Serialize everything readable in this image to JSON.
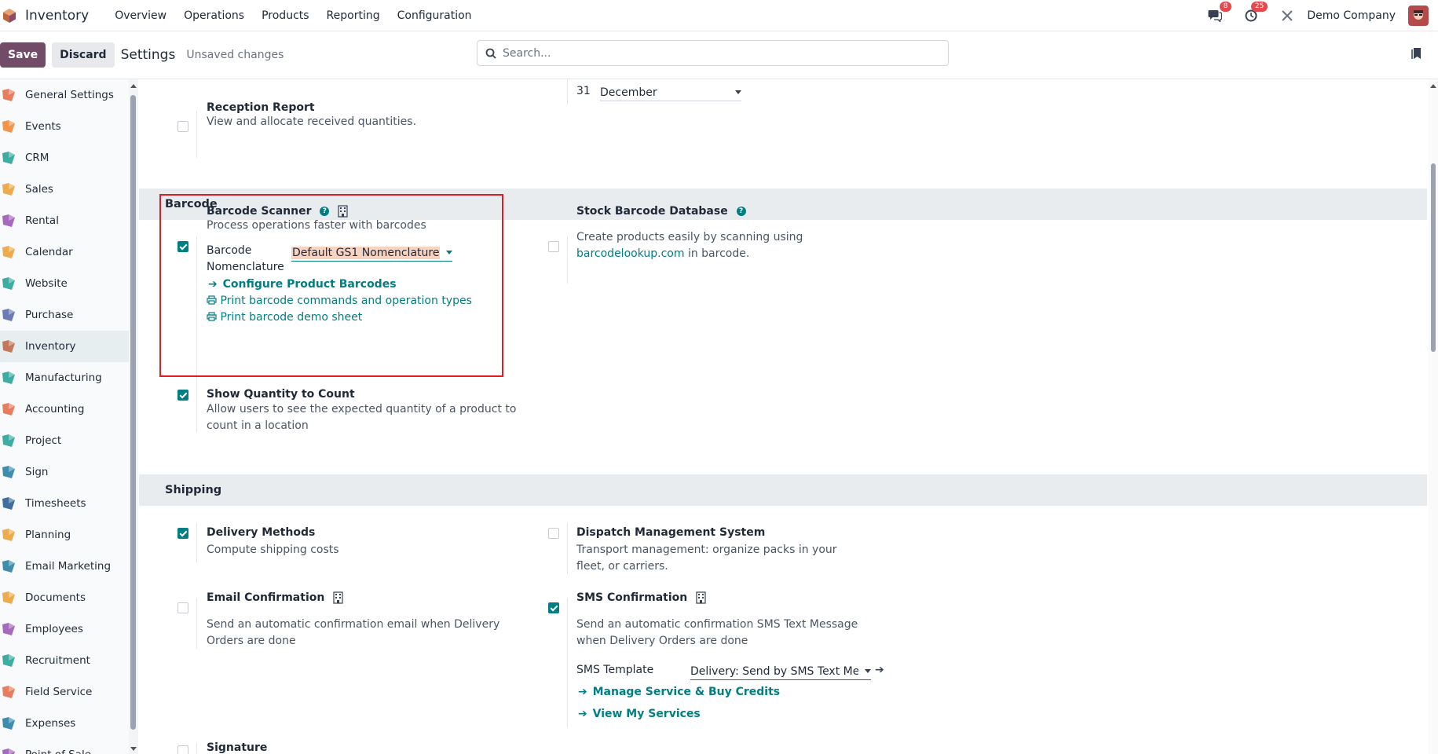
{
  "navbar": {
    "app_name": "Inventory",
    "menu": [
      "Overview",
      "Operations",
      "Products",
      "Reporting",
      "Configuration"
    ],
    "messages_badge": "8",
    "activities_badge": "25",
    "company": "Demo Company"
  },
  "control_panel": {
    "save_label": "Save",
    "discard_label": "Discard",
    "title": "Settings",
    "unsaved": "Unsaved changes",
    "search_placeholder": "Search..."
  },
  "sidebar": {
    "items": [
      {
        "label": "General Settings",
        "icon": "general-settings-icon",
        "color": "#e46f4e"
      },
      {
        "label": "Events",
        "icon": "events-icon",
        "color": "#f08a38"
      },
      {
        "label": "CRM",
        "icon": "crm-icon",
        "color": "#2aa39a"
      },
      {
        "label": "Sales",
        "icon": "sales-icon",
        "color": "#e9a23b"
      },
      {
        "label": "Rental",
        "icon": "rental-icon",
        "color": "#9b59b6"
      },
      {
        "label": "Calendar",
        "icon": "calendar-icon",
        "color": "#e9a23b"
      },
      {
        "label": "Website",
        "icon": "website-icon",
        "color": "#2aa39a"
      },
      {
        "label": "Purchase",
        "icon": "purchase-icon",
        "color": "#5b6dae"
      },
      {
        "label": "Inventory",
        "icon": "inventory-icon",
        "color": "#c06a4a"
      },
      {
        "label": "Manufacturing",
        "icon": "manufacturing-icon",
        "color": "#2aa39a"
      },
      {
        "label": "Accounting",
        "icon": "accounting-icon",
        "color": "#e46f4e"
      },
      {
        "label": "Project",
        "icon": "project-icon",
        "color": "#2aa39a"
      },
      {
        "label": "Sign",
        "icon": "sign-icon",
        "color": "#2a7fa3"
      },
      {
        "label": "Timesheets",
        "icon": "timesheets-icon",
        "color": "#2a5f8f"
      },
      {
        "label": "Planning",
        "icon": "planning-icon",
        "color": "#e9a23b"
      },
      {
        "label": "Email Marketing",
        "icon": "email-marketing-icon",
        "color": "#2a7fa3"
      },
      {
        "label": "Documents",
        "icon": "documents-icon",
        "color": "#e9a23b"
      },
      {
        "label": "Employees",
        "icon": "employees-icon",
        "color": "#9b59b6"
      },
      {
        "label": "Recruitment",
        "icon": "recruitment-icon",
        "color": "#2aa39a"
      },
      {
        "label": "Field Service",
        "icon": "field-service-icon",
        "color": "#e46f4e"
      },
      {
        "label": "Expenses",
        "icon": "expenses-icon",
        "color": "#2a7fa3"
      },
      {
        "label": "Point of Sale",
        "icon": "point-of-sale-icon",
        "color": "#9b59b6"
      }
    ],
    "active_index": 8
  },
  "top_fragment": {
    "day": "31",
    "month": "December"
  },
  "reception_report": {
    "title": "Reception Report",
    "desc": "View and allocate received quantities.",
    "checked": false
  },
  "barcode": {
    "section_title": "Barcode",
    "scanner": {
      "title": "Barcode Scanner",
      "desc": "Process operations faster with barcodes",
      "nomenclature_label": "Barcode Nomenclature",
      "nomenclature_value": "Default GS1 Nomenclature",
      "configure_link": "Configure Product Barcodes",
      "print_commands_link": "Print barcode commands and operation types",
      "print_demo_link": "Print barcode demo sheet",
      "checked": true
    },
    "stock_db": {
      "title": "Stock Barcode Database",
      "desc_before": "Create products easily by scanning using",
      "link": "barcodelookup.com",
      "desc_after": "in barcode.",
      "checked": false
    },
    "show_qty": {
      "title": "Show Quantity to Count",
      "desc": "Allow users to see the expected quantity of a product to count in a location",
      "checked": true
    }
  },
  "shipping": {
    "section_title": "Shipping",
    "delivery_methods": {
      "title": "Delivery Methods",
      "desc": "Compute shipping costs",
      "checked": true
    },
    "dispatch": {
      "title": "Dispatch Management System",
      "desc": "Transport management: organize packs in your fleet, or carriers.",
      "checked": false
    },
    "email_confirm": {
      "title": "Email Confirmation",
      "desc": "Send an automatic confirmation email when Delivery Orders are done",
      "checked": false
    },
    "sms_confirm": {
      "title": "SMS Confirmation",
      "desc": "Send an automatic confirmation SMS Text Message when Delivery Orders are done",
      "template_label": "SMS Template",
      "template_value": "Delivery: Send by SMS Text Messa",
      "manage_link": "Manage Service & Buy Credits",
      "services_link": "View My Services",
      "checked": true
    },
    "signature": {
      "title": "Signature",
      "checked": false
    }
  },
  "colors": {
    "accent": "#017e84",
    "brand": "#714b67",
    "highlight": "#e31b23"
  }
}
